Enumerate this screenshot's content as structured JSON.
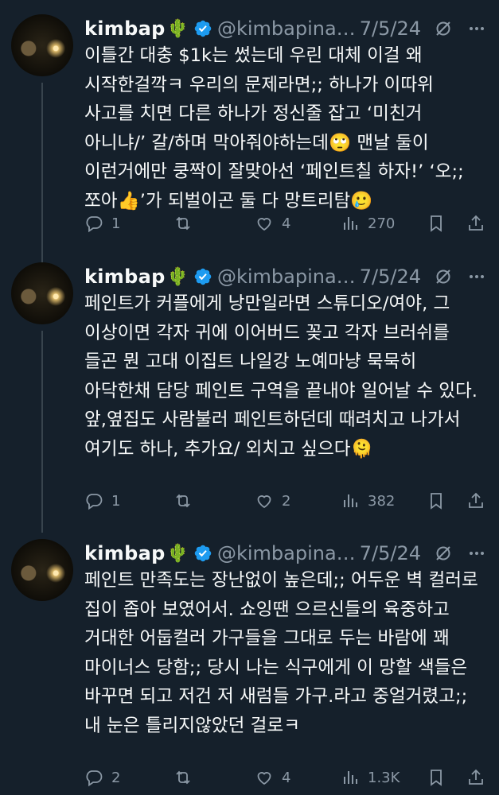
{
  "tweets": [
    {
      "name": "kimbap",
      "name_emoji": "🌵",
      "handle": "@kimbapina…",
      "date": "7/5/24",
      "text": "이틀간 대충 $1k는 썼는데 우린 대체 이걸 왜 시작한걸깍ㅋ 우리의 문제라면;; 하나가 이따위 사고를 치면 다른 하나가 정신줄 잡고 ‘미친거 아니냐/’ 갈/하며 막아줘야하는데🙄 맨날 둘이 이런거에만 쿵짝이 잘맞아선 ‘페인트칠 하자!’ ‘오;; 쪼아👍’가 되벌이곤 둘 다 망트리탐🥲",
      "replies": "1",
      "reposts": "",
      "likes": "4",
      "views": "270"
    },
    {
      "name": "kimbap",
      "name_emoji": "🌵",
      "handle": "@kimbapina…",
      "date": "7/5/24",
      "text": "페인트가 커플에게 낭만일라면 스튜디오/여야, 그 이상이면 각자 귀에 이어버드 꽂고 각자 브러쉬를 들곤 뭔 고대 이집트 나일강 노예마냥 묵묵히 아닥한채 담당 페인트 구역을 끝내야 일어날 수 있다. 앞,옆집도 사람불러 페인트하던데 때려치고 나가서 여기도 하나, 추가요/ 외치고 싶으다🫠",
      "replies": "1",
      "reposts": "",
      "likes": "2",
      "views": "382"
    },
    {
      "name": "kimbap",
      "name_emoji": "🌵",
      "handle": "@kimbapina…",
      "date": "7/5/24",
      "text": "페인트 만족도는 장난없이 높은데;; 어두운 벽 컬러로 집이 좁아 보였어서. 쇼잉땐 으르신들의 육중하고 거대한 어둡컬러 가구들을 그대로 두는 바람에 꽤 마이너스 당함;; 당시 나는 식구에게 이 망할 색들은 바꾸면 되고 저건 저 새럼들 가구.라고 중얼거렸고;; 내 눈은 틀리지않았던 걸로ㅋ",
      "replies": "2",
      "reposts": "",
      "likes": "4",
      "views": "1.3K"
    }
  ],
  "colors": {
    "background": "#15202b",
    "text": "#f7f9f9",
    "muted": "#8b98a5",
    "verified": "#1d9bf0"
  }
}
